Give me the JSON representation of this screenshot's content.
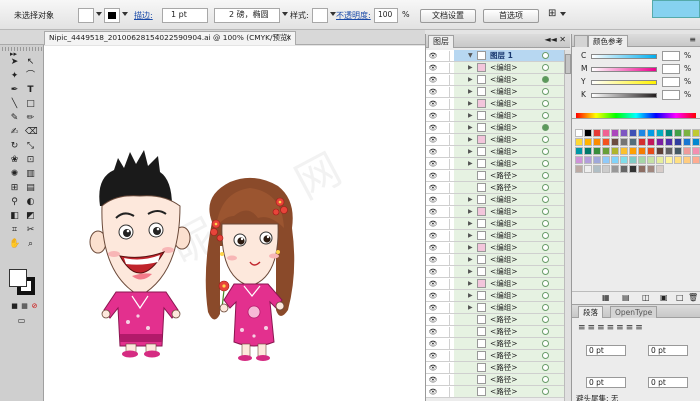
{
  "control_bar": {
    "selection_status": "未选择对象",
    "stroke_label": "描边:",
    "stroke_weight": "1 pt",
    "brush_label": "2 磅，椭圆",
    "style_label": "样式:",
    "opacity_label": "不透明度:",
    "opacity_value": "100",
    "opacity_unit": "%",
    "doc_setup_button": "文档设置",
    "prefs_button": "首选项"
  },
  "document_tab": {
    "title": "Nipic_4449518_20100628154022590904.ai @ 100% (CMYK/预览)",
    "close": "×"
  },
  "watermark": "昵 图 网",
  "layers_panel": {
    "tab": "图层",
    "controls": "◄◄ ✕",
    "rows": [
      {
        "name": "图层 1",
        "kind": "layer",
        "circle": "empty"
      },
      {
        "name": "<编组>",
        "kind": "group",
        "circle": "empty"
      },
      {
        "name": "<编组>",
        "kind": "group",
        "circle": "filled"
      },
      {
        "name": "<编组>",
        "kind": "group",
        "circle": "empty"
      },
      {
        "name": "<编组>",
        "kind": "group",
        "circle": "empty"
      },
      {
        "name": "<编组>",
        "kind": "group",
        "circle": "empty"
      },
      {
        "name": "<编组>",
        "kind": "group",
        "circle": "filled"
      },
      {
        "name": "<编组>",
        "kind": "group",
        "circle": "empty"
      },
      {
        "name": "<编组>",
        "kind": "group",
        "circle": "empty"
      },
      {
        "name": "<编组>",
        "kind": "group",
        "circle": "empty"
      },
      {
        "name": "<路径>",
        "kind": "path",
        "circle": "empty"
      },
      {
        "name": "<路径>",
        "kind": "path",
        "circle": "empty"
      },
      {
        "name": "<编组>",
        "kind": "group",
        "circle": "empty"
      },
      {
        "name": "<编组>",
        "kind": "group",
        "circle": "empty"
      },
      {
        "name": "<编组>",
        "kind": "group",
        "circle": "empty"
      },
      {
        "name": "<编组>",
        "kind": "group",
        "circle": "empty"
      },
      {
        "name": "<编组>",
        "kind": "group",
        "circle": "empty"
      },
      {
        "name": "<编组>",
        "kind": "group",
        "circle": "empty"
      },
      {
        "name": "<编组>",
        "kind": "group",
        "circle": "empty"
      },
      {
        "name": "<编组>",
        "kind": "group",
        "circle": "empty"
      },
      {
        "name": "<编组>",
        "kind": "group",
        "circle": "empty"
      },
      {
        "name": "<编组>",
        "kind": "group",
        "circle": "empty"
      },
      {
        "name": "<路径>",
        "kind": "path",
        "circle": "empty"
      },
      {
        "name": "<路径>",
        "kind": "path",
        "circle": "empty"
      },
      {
        "name": "<路径>",
        "kind": "path",
        "circle": "empty"
      },
      {
        "name": "<路径>",
        "kind": "path",
        "circle": "empty"
      },
      {
        "name": "<路径>",
        "kind": "path",
        "circle": "empty"
      },
      {
        "name": "<路径>",
        "kind": "path",
        "circle": "empty"
      },
      {
        "name": "<路径>",
        "kind": "path",
        "circle": "empty"
      }
    ]
  },
  "color_panel": {
    "tab_active": "颜色参考",
    "tab_other": "",
    "channels": [
      {
        "label": "C",
        "color": "#00aeef"
      },
      {
        "label": "M",
        "color": "#ec008c"
      },
      {
        "label": "Y",
        "color": "#fff200"
      },
      {
        "label": "K",
        "color": "#231f20"
      }
    ],
    "unit": "%"
  },
  "paragraph_panel": {
    "tab_active": "段落",
    "tab_other": "OpenType",
    "fields": [
      "0 pt",
      "0 pt",
      "0 pt",
      "0 pt"
    ],
    "bottom_text": "避头尾集: 无"
  },
  "colors": {
    "pink_dress": "#e3308e",
    "layer_band": "#e6f2e2",
    "selection_band": "#b7d7f1"
  }
}
